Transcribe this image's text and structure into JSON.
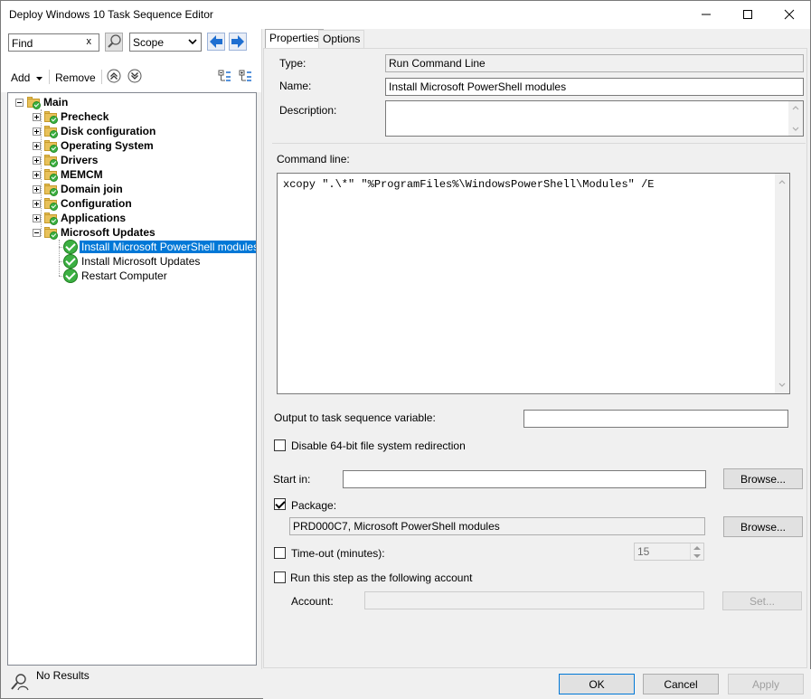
{
  "window": {
    "title": "Deploy Windows 10 Task Sequence Editor"
  },
  "search": {
    "value": "Find",
    "clear": "x",
    "scope": "Scope"
  },
  "toolbar": {
    "add": "Add",
    "remove": "Remove"
  },
  "tree": {
    "root": "Main",
    "groups": [
      "Precheck",
      "Disk configuration",
      "Operating System",
      "Drivers",
      "MEMCM",
      "Domain join",
      "Configuration",
      "Applications",
      "Microsoft Updates"
    ],
    "steps": [
      "Install Microsoft PowerShell modules",
      "Install Microsoft Updates",
      "Restart Computer"
    ]
  },
  "status": {
    "text": "No Results"
  },
  "tabs": {
    "properties": "Properties",
    "options": "Options"
  },
  "props": {
    "type_label": "Type:",
    "type_value": "Run Command Line",
    "name_label": "Name:",
    "name_value": "Install Microsoft PowerShell modules",
    "description_label": "Description:",
    "description_value": "",
    "command_label": "Command line:",
    "command_value": "xcopy \".\\*\" \"%ProgramFiles%\\WindowsPowerShell\\Modules\" /E",
    "output_label": "Output to task sequence variable:",
    "output_value": "",
    "disable64_label": "Disable 64-bit file system redirection",
    "startin_label": "Start in:",
    "startin_value": "",
    "browse1": "Browse...",
    "package_label": "Package:",
    "package_value": "PRD000C7, Microsoft PowerShell modules",
    "browse2": "Browse...",
    "timeout_label": "Time-out (minutes):",
    "timeout_value": "15",
    "runas_label": "Run this step as the following account",
    "account_label": "Account:",
    "account_value": "",
    "set_button": "Set..."
  },
  "buttons": {
    "ok": "OK",
    "cancel": "Cancel",
    "apply": "Apply"
  },
  "colors": {
    "selection": "#0078d7",
    "nav_arrow": "#1f6fd1",
    "check_green": "#3cb043",
    "folder": "#e8c15a"
  }
}
